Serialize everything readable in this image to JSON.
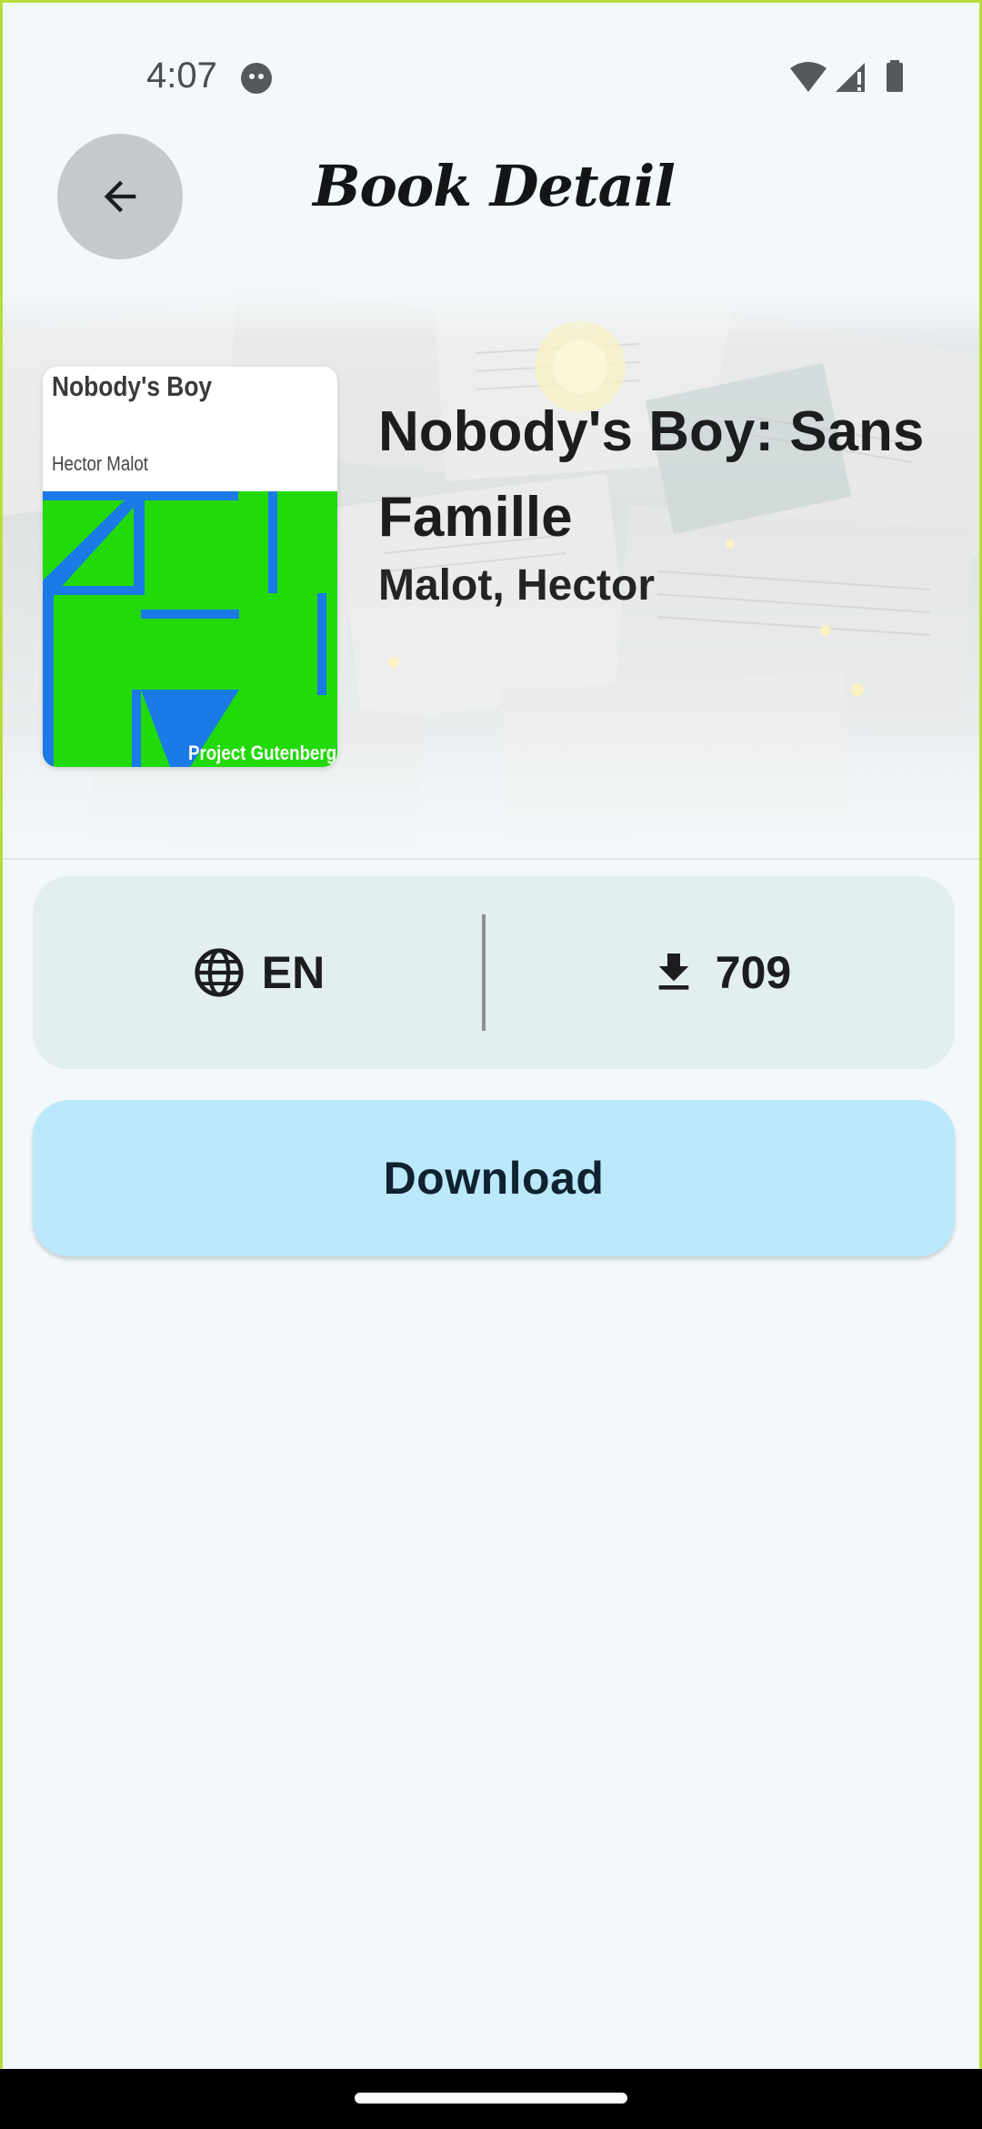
{
  "status_bar": {
    "time": "4:07"
  },
  "app_bar": {
    "title": "Book Detail",
    "back_icon": "arrow-back-icon"
  },
  "book": {
    "title": "Nobody's Boy: Sans Famille",
    "author": "Malot, Hector",
    "cover": {
      "title": "Nobody's Boy",
      "author": "Hector Malot",
      "publisher": "Project Gutenberg",
      "colors": {
        "background": "#22d90a",
        "accent": "#1a7be6"
      }
    }
  },
  "stats": {
    "language": {
      "icon": "globe-icon",
      "value": "EN"
    },
    "downloads": {
      "icon": "download-icon",
      "value": "709"
    }
  },
  "actions": {
    "download_label": "Download"
  },
  "colors": {
    "background": "#f3f8fb",
    "card": "#e3eef1",
    "button": "#bce8fb",
    "frame": "#b6dd3a"
  }
}
